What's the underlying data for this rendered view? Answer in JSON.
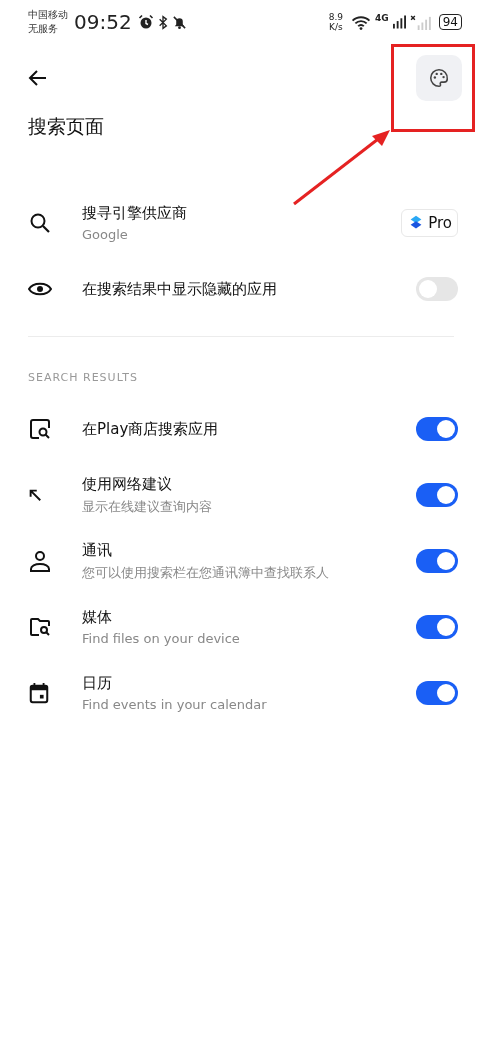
{
  "status_bar": {
    "carrier": "中国移动",
    "service": "无服务",
    "time": "09:52",
    "speed": "8.9",
    "speed_unit": "K/s",
    "network": "4G",
    "battery": "94"
  },
  "header": {
    "title": "搜索页面"
  },
  "general": [
    {
      "kind": "link",
      "title": "搜寻引擎供应商",
      "subtitle": "Google",
      "badge": "Pro"
    },
    {
      "kind": "toggle",
      "title": "在搜索结果中显示隐藏的应用",
      "on": false
    }
  ],
  "section": {
    "title": "SEARCH RESULTS"
  },
  "results": [
    {
      "kind": "toggle",
      "title": "在Play商店搜索应用",
      "on": true
    },
    {
      "kind": "toggle",
      "title": "使用网络建议",
      "subtitle": "显示在线建议查询内容",
      "on": true
    },
    {
      "kind": "toggle",
      "title": "通讯",
      "subtitle": "您可以使用搜索栏在您通讯簿中查找联系人",
      "on": true
    },
    {
      "kind": "toggle",
      "title": "媒体",
      "subtitle": "Find files on your device",
      "on": true
    },
    {
      "kind": "toggle",
      "title": "日历",
      "subtitle": "Find events in your calendar",
      "on": true
    }
  ]
}
